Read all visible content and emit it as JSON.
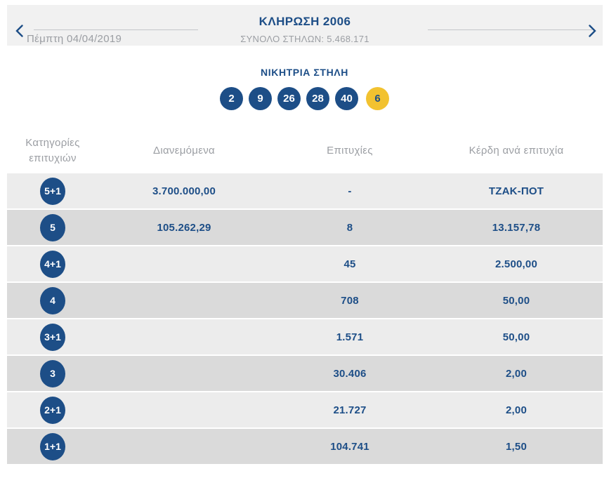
{
  "header": {
    "title": "ΚΛΗΡΩΣΗ 2006",
    "subtitle": "ΣΥΝΟΛΟ ΣΤΗΛΩΝ: 5.468.171",
    "date": "Πέμπτη 04/04/2019",
    "prev_icon": "chevron-left",
    "next_icon": "chevron-right"
  },
  "winning": {
    "heading": "ΝΙΚΗΤΡΙΑ ΣΤΗΛΗ",
    "numbers": [
      "2",
      "9",
      "26",
      "28",
      "40"
    ],
    "joker": "6"
  },
  "table": {
    "columns": [
      "Κατηγορίες επιτυχιών",
      "Διανεμόμενα",
      "Επιτυχίες",
      "Κέρδη ανά επιτυχία"
    ],
    "rows": [
      {
        "category": "5+1",
        "distributed": "3.700.000,00",
        "winners": "-",
        "prize": "ΤΖΑΚ-ΠΟΤ"
      },
      {
        "category": "5",
        "distributed": "105.262,29",
        "winners": "8",
        "prize": "13.157,78"
      },
      {
        "category": "4+1",
        "distributed": "",
        "winners": "45",
        "prize": "2.500,00"
      },
      {
        "category": "4",
        "distributed": "",
        "winners": "708",
        "prize": "50,00"
      },
      {
        "category": "3+1",
        "distributed": "",
        "winners": "1.571",
        "prize": "50,00"
      },
      {
        "category": "3",
        "distributed": "",
        "winners": "30.406",
        "prize": "2,00"
      },
      {
        "category": "2+1",
        "distributed": "",
        "winners": "21.727",
        "prize": "2,00"
      },
      {
        "category": "1+1",
        "distributed": "",
        "winners": "104.741",
        "prize": "1,50"
      }
    ]
  },
  "colors": {
    "brand_blue": "#1d4e87",
    "joker_yellow": "#f2c230",
    "row_light": "#ececec",
    "row_dark": "#dadada",
    "band_bg": "#f1f1f1",
    "muted_text": "#9b9ea3"
  }
}
